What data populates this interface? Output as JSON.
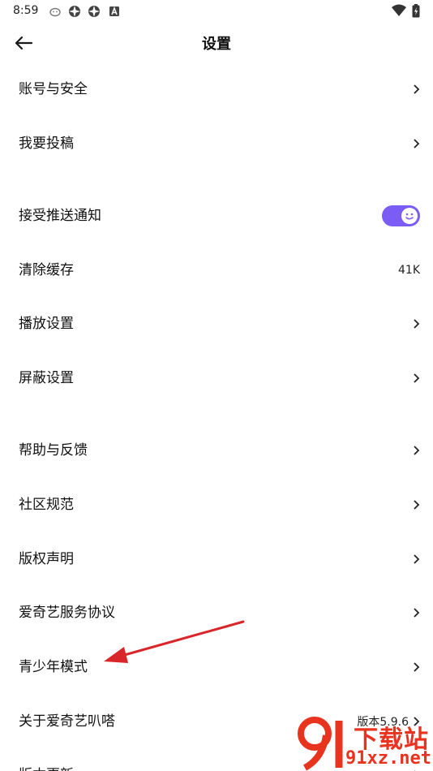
{
  "status_bar": {
    "time": "8:59",
    "icons": [
      "cat-icon",
      "aperture-icon",
      "aperture-icon",
      "a-badge-icon"
    ],
    "right_icons": [
      "wifi-icon",
      "battery-charging-icon"
    ]
  },
  "header": {
    "title": "设置",
    "back_icon": "arrow-left-icon"
  },
  "settings": [
    {
      "id": "account",
      "label": "账号与安全",
      "type": "chevron"
    },
    {
      "id": "submit",
      "label": "我要投稿",
      "type": "chevron"
    },
    {
      "id": "push",
      "label": "接受推送通知",
      "type": "toggle",
      "on": true
    },
    {
      "id": "cache",
      "label": "清除缓存",
      "type": "value",
      "value": "41K"
    },
    {
      "id": "playback",
      "label": "播放设置",
      "type": "chevron"
    },
    {
      "id": "block",
      "label": "屏蔽设置",
      "type": "chevron"
    },
    {
      "id": "help",
      "label": "帮助与反馈",
      "type": "chevron"
    },
    {
      "id": "community",
      "label": "社区规范",
      "type": "chevron"
    },
    {
      "id": "copyright",
      "label": "版权声明",
      "type": "chevron"
    },
    {
      "id": "agreement",
      "label": "爱奇艺服务协议",
      "type": "chevron"
    },
    {
      "id": "teen",
      "label": "青少年模式",
      "type": "chevron"
    },
    {
      "id": "about",
      "label": "关于爱奇艺叭嗒",
      "type": "value-chevron",
      "value": "版本5.9.6"
    },
    {
      "id": "update",
      "label": "版本更新",
      "type": "chevron"
    }
  ],
  "watermark": {
    "text_top": "下载站",
    "text_bottom": "91xz.net"
  },
  "colors": {
    "accent": "#7b5cf5",
    "annotation_arrow": "#d9262b",
    "watermark": "#e8331f"
  }
}
